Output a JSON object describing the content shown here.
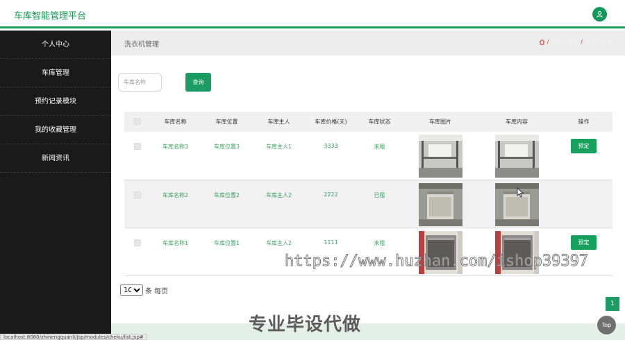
{
  "header": {
    "app_title": "车库智能管理平台",
    "user_icon": "user-icon"
  },
  "sidebar": {
    "items": [
      {
        "label": "个人中心"
      },
      {
        "label": "车库管理"
      },
      {
        "label": "预约记录模块"
      },
      {
        "label": "我的收藏管理"
      },
      {
        "label": "新闻资讯"
      }
    ]
  },
  "breadcrumb": {
    "page_title": "洗衣机管理",
    "home_icon": "home-icon",
    "crumbs": [
      "洗衣机管理",
      "洗衣机列表"
    ]
  },
  "search": {
    "placeholder": "车库名称",
    "button_label": "查询"
  },
  "table": {
    "headers": [
      "",
      "车库名称",
      "车库位置",
      "车库主人",
      "车库价格(天)",
      "车库状态",
      "车库图片",
      "车库内容",
      "操作"
    ],
    "rows": [
      {
        "name": "车库名称3",
        "location": "车库位置3",
        "owner": "车库主人1",
        "price": "3333",
        "status": "未租",
        "action": "预定"
      },
      {
        "name": "车库名称2",
        "location": "车库位置2",
        "owner": "车库主人2",
        "price": "2222",
        "status": "已租",
        "action": ""
      },
      {
        "name": "车库名称1",
        "location": "车库位置1",
        "owner": "车库主人2",
        "price": "1111",
        "status": "未租",
        "action": "预定"
      }
    ]
  },
  "pagination": {
    "page_size": "10",
    "page_size_options": [
      "10"
    ],
    "page_size_suffix": "条 每页",
    "current_page": "1"
  },
  "overlays": {
    "watermark_url": "https://www.huzhan.com/ishop39397",
    "watermark_text": "专业毕设代做",
    "status_url": "localhost:8080/zhinengquanli/jsp/modules/cheku/list.jsp#",
    "top_button": "Top"
  },
  "colors": {
    "accent": "#1a9c64",
    "sidebar_bg": "#1a1a1a",
    "link_green": "#3aa15e"
  }
}
